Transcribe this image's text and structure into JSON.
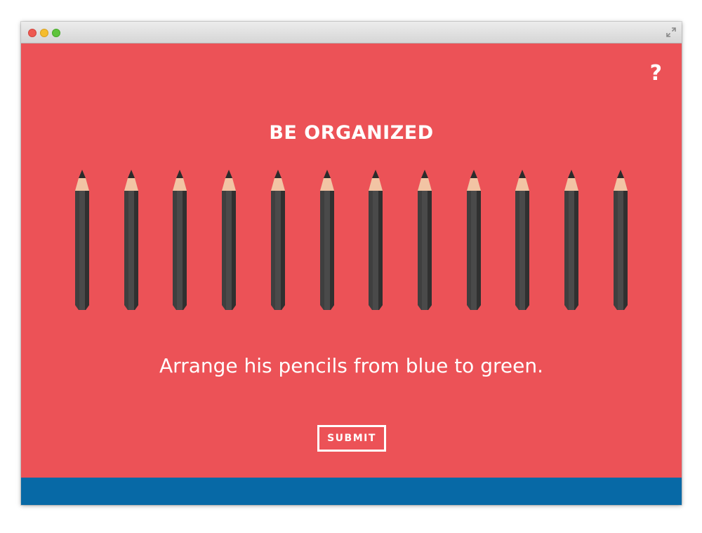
{
  "window": {
    "controls": [
      "close",
      "minimize",
      "zoom"
    ],
    "fullscreen_icon": "fullscreen-icon"
  },
  "page": {
    "help_label": "?",
    "title": "BE ORGANIZED",
    "instruction": "Arrange his pencils from blue to green.",
    "submit_label": "SUBMIT",
    "pencil_count": 12
  },
  "colors": {
    "background": "#ec5257",
    "footer": "#0769a6",
    "pencil_body": "#3f3f3f",
    "pencil_wood": "#f2c4a4",
    "pencil_lead": "#2c2c2c",
    "text": "#ffffff"
  }
}
